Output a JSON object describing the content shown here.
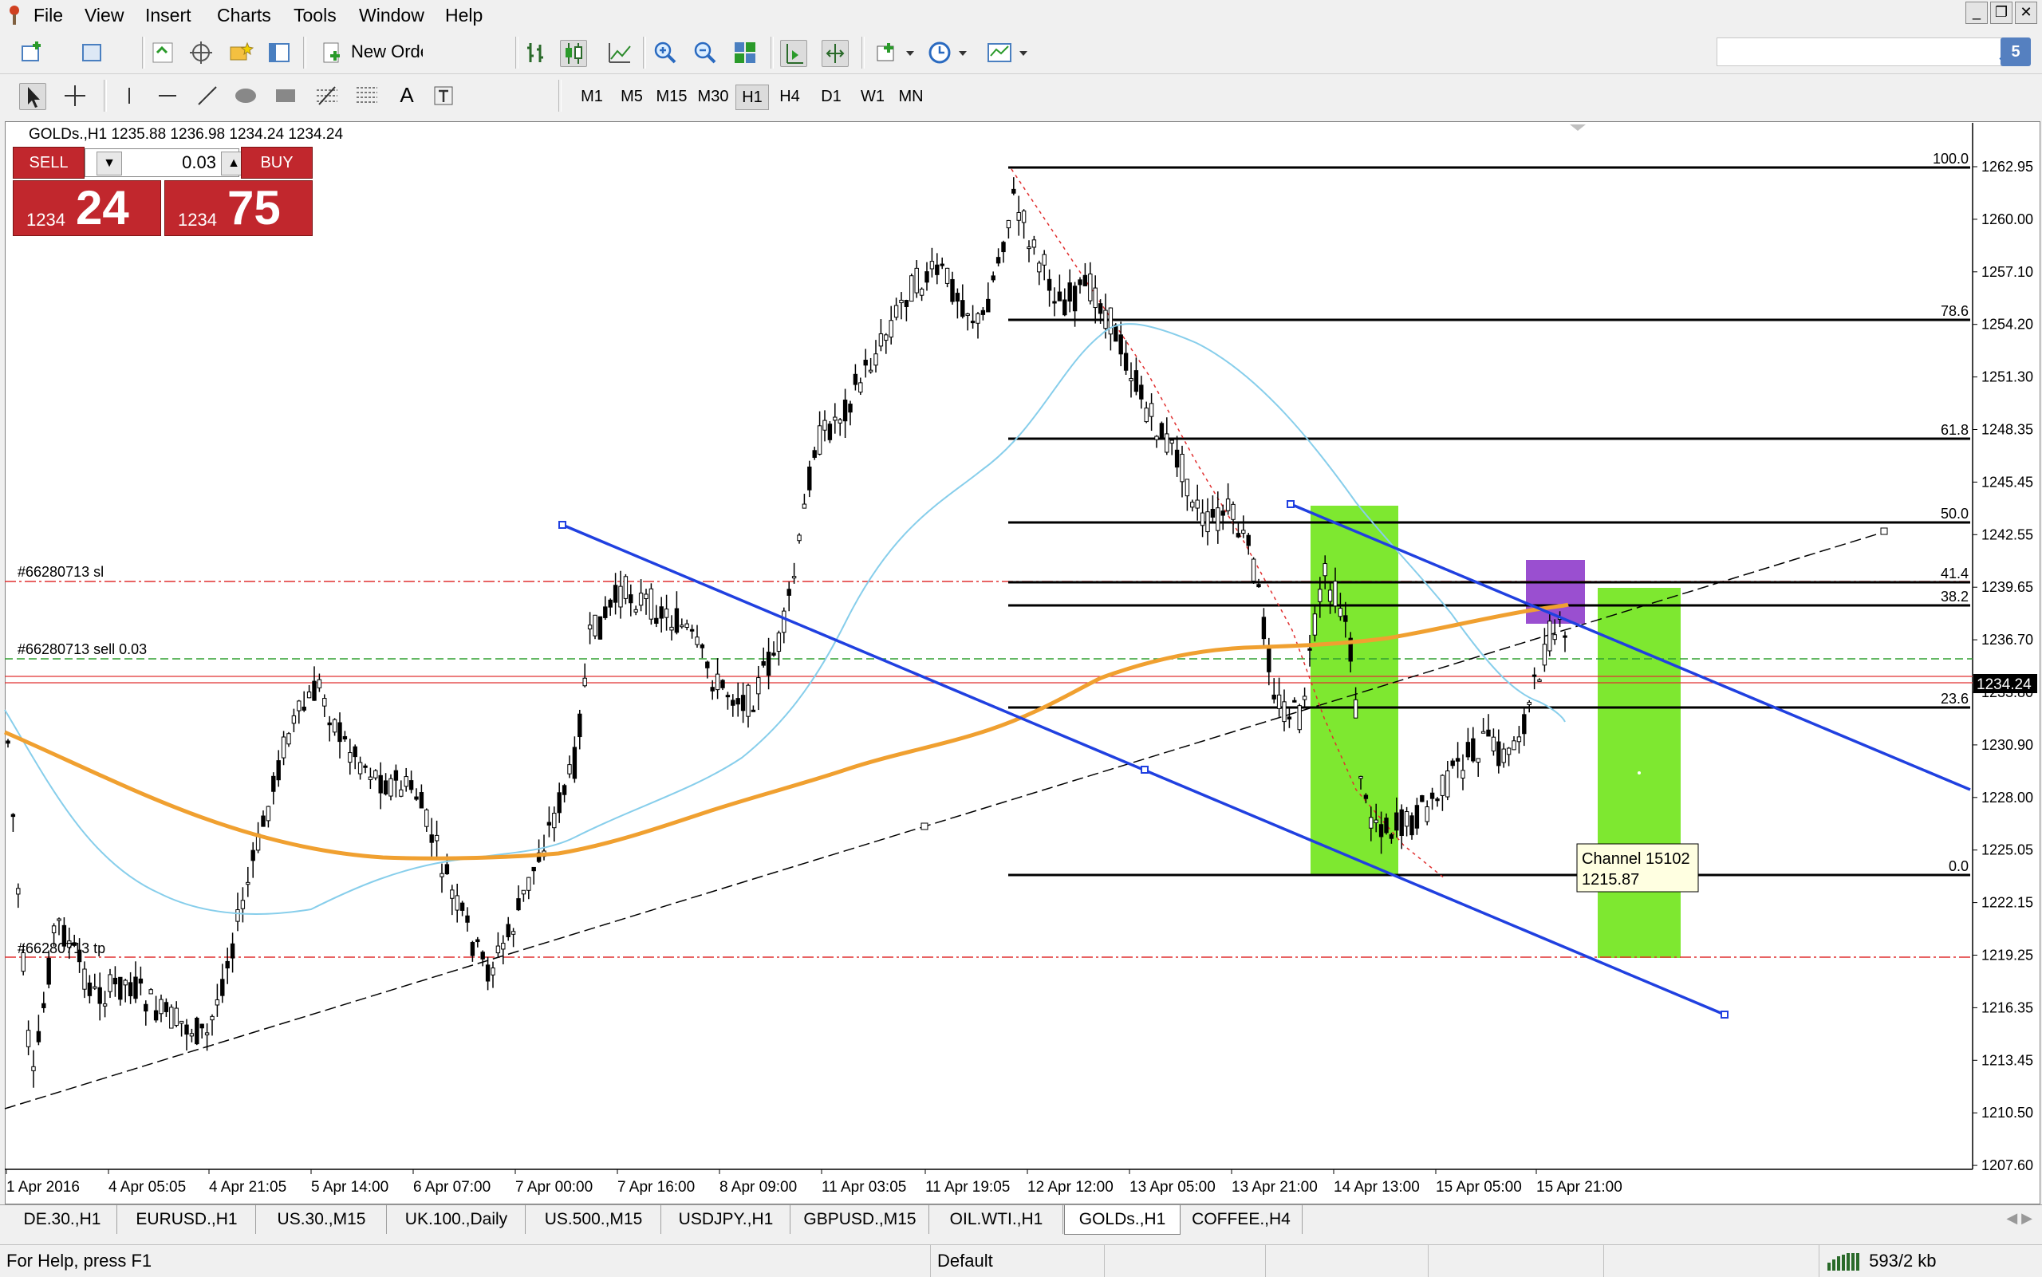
{
  "menu": [
    "File",
    "View",
    "Insert",
    "Charts",
    "Tools",
    "Window",
    "Help"
  ],
  "window_controls": [
    "_",
    "❐",
    "✕"
  ],
  "toolbar": {
    "new_order_label": "New Order",
    "search_placeholder": "",
    "help_badge": "5"
  },
  "timeframes": [
    "M1",
    "M5",
    "M15",
    "M30",
    "H1",
    "H4",
    "D1",
    "W1",
    "MN"
  ],
  "active_timeframe": "H1",
  "chart": {
    "title": "GOLDs.,H1  1235.88 1236.98 1234.24 1234.24",
    "symbol": "GOLDs.,H1",
    "trade_panel": {
      "sell_label": "SELL",
      "buy_label": "BUY",
      "lot": "0.03",
      "bid_small": "1234",
      "bid_big": "24",
      "ask_small": "1234",
      "ask_big": "75"
    },
    "order_labels": {
      "sl": "#66280713 sl",
      "sell": "#66280713 sell 0.03",
      "tp": "#66280713 tp"
    },
    "current_price_label": "1234.24",
    "price_ticks": [
      "1262.95",
      "1260.00",
      "1257.10",
      "1254.20",
      "1251.30",
      "1248.35",
      "1245.45",
      "1242.55",
      "1239.65",
      "1236.70",
      "1233.80",
      "1230.90",
      "1228.00",
      "1225.05",
      "1222.15",
      "1219.25",
      "1216.35",
      "1213.45",
      "1210.50",
      "1207.60"
    ],
    "time_ticks": [
      "1 Apr 2016",
      "4 Apr 05:05",
      "4 Apr 21:05",
      "5 Apr 14:00",
      "6 Apr 07:00",
      "7 Apr 00:00",
      "7 Apr 16:00",
      "8 Apr 09:00",
      "11 Apr 03:05",
      "11 Apr 19:05",
      "12 Apr 12:00",
      "13 Apr 05:00",
      "13 Apr 21:00",
      "14 Apr 13:00",
      "15 Apr 05:00",
      "15 Apr 21:00"
    ],
    "fibo_levels": [
      "100.0",
      "78.6",
      "61.8",
      "50.0",
      "41.4",
      "38.2",
      "23.6",
      "0.0"
    ],
    "tooltip": {
      "line1": "Channel 15102",
      "line2": "1215.87"
    },
    "colors": {
      "candle": "#000000",
      "ma_fast": "#87ceeb",
      "ma_slow": "#f0a030",
      "channel": "#2040e0",
      "rect_green": "#7ee830",
      "rect_purple": "#9a4fd0",
      "sl_tp_line": "#e03030",
      "entry_line": "#30a030",
      "price_label_bg": "#000000"
    }
  },
  "tabs": [
    "DE.30.,H1",
    "EURUSD.,H1",
    "US.30.,M15",
    "UK.100.,Daily",
    "US.500.,M15",
    "USDJPY.,H1",
    "GBPUSD.,M15",
    "OIL.WTI.,H1",
    "GOLDs.,H1",
    "COFFEE.,H4"
  ],
  "active_tab": "GOLDs.,H1",
  "status": {
    "help": "For Help, press F1",
    "profile": "Default",
    "traffic": "593/2 kb"
  }
}
